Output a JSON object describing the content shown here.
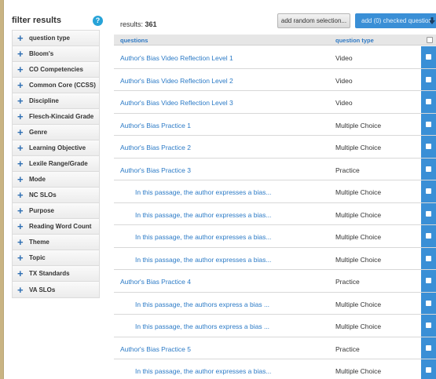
{
  "sidebar": {
    "title": "filter results",
    "help_icon": "?",
    "filters": [
      {
        "label": "question type"
      },
      {
        "label": "Bloom's"
      },
      {
        "label": "CO Competencies"
      },
      {
        "label": "Common Core (CCSS)"
      },
      {
        "label": "Discipline"
      },
      {
        "label": "Flesch-Kincaid Grade"
      },
      {
        "label": "Genre"
      },
      {
        "label": "Learning Objective"
      },
      {
        "label": "Lexile Range/Grade"
      },
      {
        "label": "Mode"
      },
      {
        "label": "NC SLOs"
      },
      {
        "label": "Purpose"
      },
      {
        "label": "Reading Word Count"
      },
      {
        "label": "Theme"
      },
      {
        "label": "Topic"
      },
      {
        "label": "TX Standards"
      },
      {
        "label": "VA SLOs"
      }
    ]
  },
  "toolbar": {
    "results_label": "results:",
    "results_count": "361",
    "random_button": "add random selection...",
    "add_checked_button": "add (0) checked question"
  },
  "table": {
    "col_questions": "questions",
    "col_type": "question type",
    "rows": [
      {
        "question": "Author's Bias Video Reflection Level 1",
        "type": "Video",
        "indent": false
      },
      {
        "question": "Author's Bias Video Reflection Level 2",
        "type": "Video",
        "indent": false
      },
      {
        "question": "Author's Bias Video Reflection Level 3",
        "type": "Video",
        "indent": false
      },
      {
        "question": "Author's Bias Practice 1",
        "type": "Multiple Choice",
        "indent": false
      },
      {
        "question": "Author's Bias Practice 2",
        "type": "Multiple Choice",
        "indent": false
      },
      {
        "question": "Author's Bias Practice 3",
        "type": "Practice",
        "indent": false
      },
      {
        "question": "In this passage, the author expresses a bias...",
        "type": "Multiple Choice",
        "indent": true
      },
      {
        "question": "In this passage, the author expresses a bias...",
        "type": "Multiple Choice",
        "indent": true
      },
      {
        "question": "In this passage, the author expresses a bias...",
        "type": "Multiple Choice",
        "indent": true
      },
      {
        "question": "In this passage, the author expresses a bias...",
        "type": "Multiple Choice",
        "indent": true
      },
      {
        "question": "Author's Bias Practice 4",
        "type": "Practice",
        "indent": false
      },
      {
        "question": "In this passage, the authors express a bias ...",
        "type": "Multiple Choice",
        "indent": true
      },
      {
        "question": "In this passage, the authors express a bias ...",
        "type": "Multiple Choice",
        "indent": true
      },
      {
        "question": "Author's Bias Practice 5",
        "type": "Practice",
        "indent": false
      },
      {
        "question": "In this passage, the author expresses a bias...",
        "type": "Multiple Choice",
        "indent": true
      }
    ]
  },
  "colors": {
    "accent": "#3a8fd6",
    "link": "#2b7ac6",
    "outer_background": "#c9b483"
  }
}
